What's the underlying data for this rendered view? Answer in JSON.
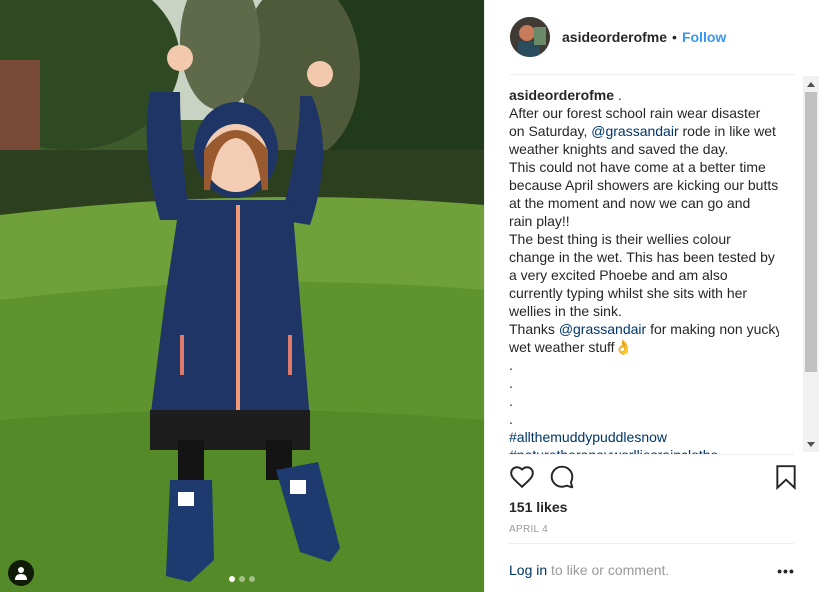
{
  "post": {
    "username": "asideorderofme",
    "bullet": "•",
    "follow_label": "Follow",
    "caption_user": "asideorderofme",
    "caption_user_suffix": " .",
    "caption_lines": [
      "After our forest school rain wear disaster",
      "on Saturday, ",
      "weather knights and saved the day.",
      "This could not have come at a better time",
      "because April showers are kicking our butts",
      "at the moment and now we can go and",
      "rain play!!",
      "The best thing is their wellies colour",
      "change in the wet. This has been tested by",
      "a very excited Phoebe and am also",
      "currently typing whilst she sits with her",
      "wellies in the sink.",
      "Thanks ",
      "wet weather stuff"
    ],
    "mention_1": "@grassandair",
    "mention_1_after": " rode in like wet",
    "mention_2": "@grassandair",
    "mention_2_after": " for making non yucky",
    "ok_emoji": "👌",
    "dot_lines": [
      ".",
      ".",
      ".",
      "."
    ],
    "hashtag_1": "#allthemuddypuddlesnow",
    "hashtag_partial": "#naturetheraneyworlliesrainclothe",
    "likes": "151 likes",
    "date": "APRIL 4",
    "login_link": "Log in",
    "login_rest": " to like or comment.",
    "more_label": "•••"
  },
  "carousel": {
    "count": 3,
    "active_index": 0
  },
  "icons": {
    "like": "heart-outline-icon",
    "comment": "speech-bubble-icon",
    "save": "bookmark-icon",
    "user_tag": "person-icon"
  },
  "colors": {
    "link": "#3897f0",
    "hashtag": "#003569",
    "muted": "#999999",
    "text": "#262626"
  }
}
